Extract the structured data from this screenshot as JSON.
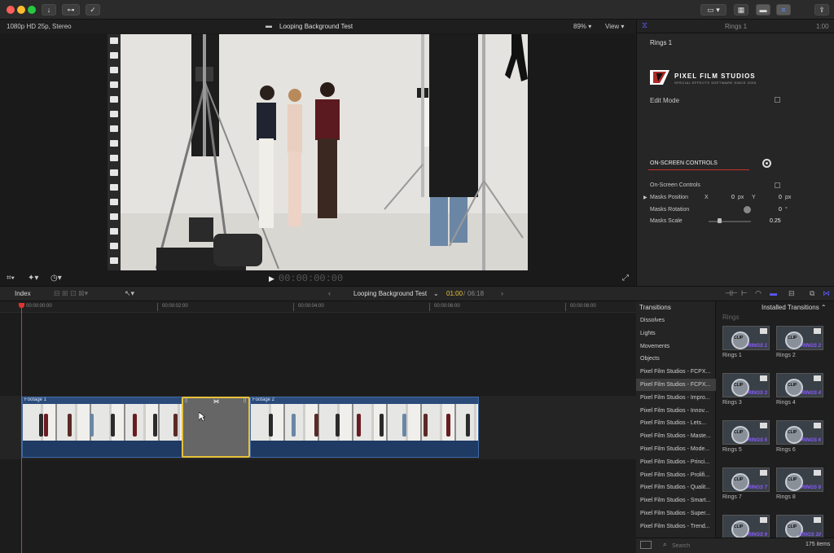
{
  "titlebar": {
    "buttons": [
      "↓",
      "⊶",
      "✓"
    ]
  },
  "viewer": {
    "format": "1080p HD 25p, Stereo",
    "title": "Looping Background Test",
    "zoom": "89%",
    "view_label": "View",
    "timecode": "00:00:00:00"
  },
  "inspector": {
    "header_title": "Rings 1",
    "header_time": "1:00",
    "effect_name": "Rings 1",
    "brand": "PIXEL FILM STUDIOS",
    "brand_sub": "SPECIAL EFFECTS SOFTWARE SINCE 2005",
    "edit_mode_label": "Edit Mode",
    "section_title": "ON-SCREEN CONTROLS",
    "rows": [
      {
        "label": "On-Screen Controls"
      },
      {
        "label": "Masks Position",
        "x_label": "X",
        "x_value": "0",
        "x_unit": "px",
        "y_label": "Y",
        "y_value": "0",
        "y_unit": "px"
      },
      {
        "label": "Masks Rotation",
        "value": "0",
        "unit": "°"
      },
      {
        "label": "Masks Scale",
        "value": "0.25",
        "slider": 0.25
      }
    ]
  },
  "timeline": {
    "index_label": "Index",
    "project_title": "Looping Background Test",
    "current_time": "01:00",
    "total_time": "06:18",
    "ruler": [
      "00:00:00:00",
      "00:00:02:00",
      "00:00:04:00",
      "00:00:06:00",
      "00:00:08:00"
    ],
    "clips": [
      {
        "label": "Footage 1"
      },
      {
        "label": "Footage 2"
      }
    ]
  },
  "transitions": {
    "header": "Transitions",
    "installed_label": "Installed Transitions",
    "group_label": "Rings",
    "categories": [
      "Dissolves",
      "Lights",
      "Movements",
      "Objects",
      "Pixel Film Studios - FCPX...",
      "Pixel Film Studios - FCPX...",
      "Pixel Film Studios - Impro...",
      "Pixel Film Studios - Innov...",
      "Pixel Film Studios - Lets...",
      "Pixel Film Studios - Maste...",
      "Pixel Film Studios - Mode...",
      "Pixel Film Studios - Princi...",
      "Pixel Film Studios - Prolifi...",
      "Pixel Film Studios - Qualit...",
      "Pixel Film Studios - Smart...",
      "Pixel Film Studios - Super...",
      "Pixel Film Studios - Trend..."
    ],
    "selected_index": 5,
    "items": [
      {
        "name": "Rings 1",
        "tag": "RINGS 1"
      },
      {
        "name": "Rings 2",
        "tag": "RINGS 2"
      },
      {
        "name": "Rings 3",
        "tag": "RINGS 3"
      },
      {
        "name": "Rings 4",
        "tag": "RINGS 4"
      },
      {
        "name": "Rings 5",
        "tag": "RINGS 5"
      },
      {
        "name": "Rings 6",
        "tag": "RINGS 6"
      },
      {
        "name": "Rings 7",
        "tag": "RINGS 7"
      },
      {
        "name": "Rings 8",
        "tag": "RINGS 8"
      },
      {
        "name": "",
        "tag": "RINGS 9"
      },
      {
        "name": "",
        "tag": "RINGS 10"
      }
    ],
    "clip_label": "CLIP",
    "search_placeholder": "Search",
    "count": "175 items"
  },
  "colors": {
    "accent": "#5a5aff",
    "selection": "#e8c23a",
    "clip_blue": "#2a4b7a",
    "section_red": "#c8302a"
  }
}
